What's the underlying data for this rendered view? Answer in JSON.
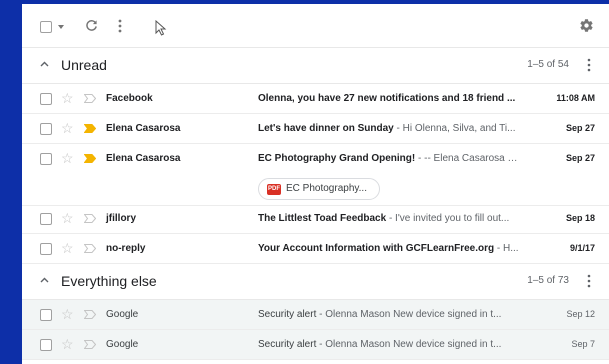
{
  "toolbar": {
    "select_icon": "checkbox-icon",
    "dropdown_icon": "caret-down-icon",
    "refresh_icon": "refresh-icon",
    "more_icon": "more-vert-icon",
    "settings_icon": "gear-icon"
  },
  "sections": [
    {
      "title": "Unread",
      "count": "1–5 of 54",
      "rows": [
        {
          "sender": "Facebook",
          "subject": "Olenna, you have 27 new notifications and 18 friend ...",
          "preview": "",
          "date": "11:08 AM",
          "important": false
        },
        {
          "sender": "Elena Casarosa",
          "subject": "Let's have dinner on Sunday",
          "preview": " - Hi Olenna, Silva, and Ti...",
          "date": "Sep 27",
          "important": true
        },
        {
          "sender": "Elena Casarosa",
          "subject": "EC Photography Grand Opening!",
          "preview": " - -- Elena Casarosa E...",
          "date": "Sep 27",
          "important": true,
          "attachment": {
            "type": "PDF",
            "label": "EC Photography..."
          }
        },
        {
          "sender": "jfillory",
          "subject": "The Littlest Toad Feedback",
          "preview": " - I've invited you to fill out...",
          "date": "Sep 18",
          "important": false
        },
        {
          "sender": "no-reply",
          "subject": "Your Account Information with GCFLearnFree.org",
          "preview": " - H...",
          "date": "9/1/17",
          "important": false
        }
      ]
    },
    {
      "title": "Everything else",
      "count": "1–5 of 73",
      "rows": [
        {
          "sender": "Google",
          "subject": "Security alert",
          "preview": " - Olenna Mason New device signed in t...",
          "date": "Sep 12",
          "important": false
        },
        {
          "sender": "Google",
          "subject": "Security alert",
          "preview": " - Olenna Mason New device signed in t...",
          "date": "Sep 7",
          "important": false
        }
      ]
    }
  ]
}
